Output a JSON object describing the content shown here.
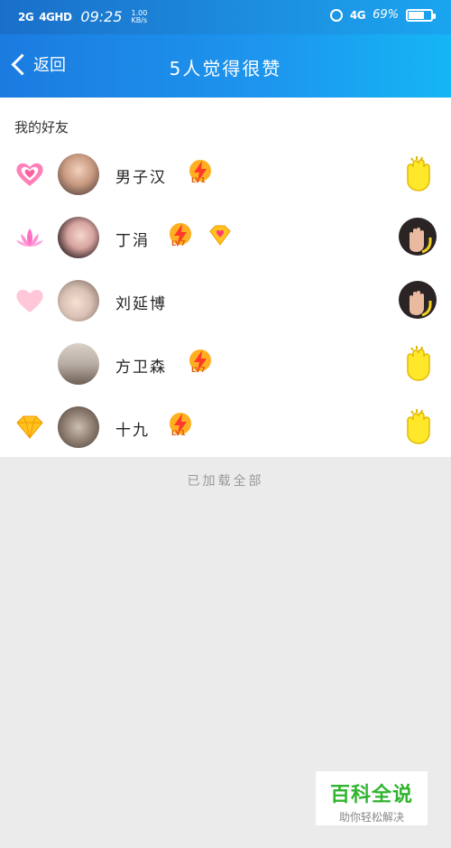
{
  "status_bar": {
    "net1": "2G",
    "net2": "4GHD",
    "time": "09:25",
    "speed": "1.00",
    "speed_unit": "KB/s",
    "net3": "4G",
    "battery": "69%"
  },
  "nav": {
    "back_label": "返回",
    "title": "5人觉得很赞"
  },
  "section_title": "我的好友",
  "friends": [
    {
      "name": "男子汉",
      "level": "LV1",
      "left_badge": "heart-badge-icon",
      "extra_badge": "",
      "right": "clap-yellow-icon"
    },
    {
      "name": "丁涓",
      "level": "LV7",
      "left_badge": "lotus-icon",
      "extra_badge": "diamond-badge-icon",
      "right": "avatar-clap-icon"
    },
    {
      "name": "刘延博",
      "level": "",
      "left_badge": "pink-heart-icon",
      "extra_badge": "",
      "right": "avatar-clap-icon"
    },
    {
      "name": "方卫森",
      "level": "LV7",
      "left_badge": "",
      "extra_badge": "",
      "right": "clap-yellow-icon"
    },
    {
      "name": "十九",
      "level": "LV1",
      "left_badge": "gold-diamond-icon",
      "extra_badge": "",
      "right": "clap-yellow-icon"
    }
  ],
  "footer": "已加载全部",
  "watermark": {
    "line1": "百科全说",
    "line2": "助你轻松解决"
  },
  "colors": {
    "header": "#1d8fe0",
    "row_background": "#ffffff",
    "page_background": "#ebebeb"
  }
}
